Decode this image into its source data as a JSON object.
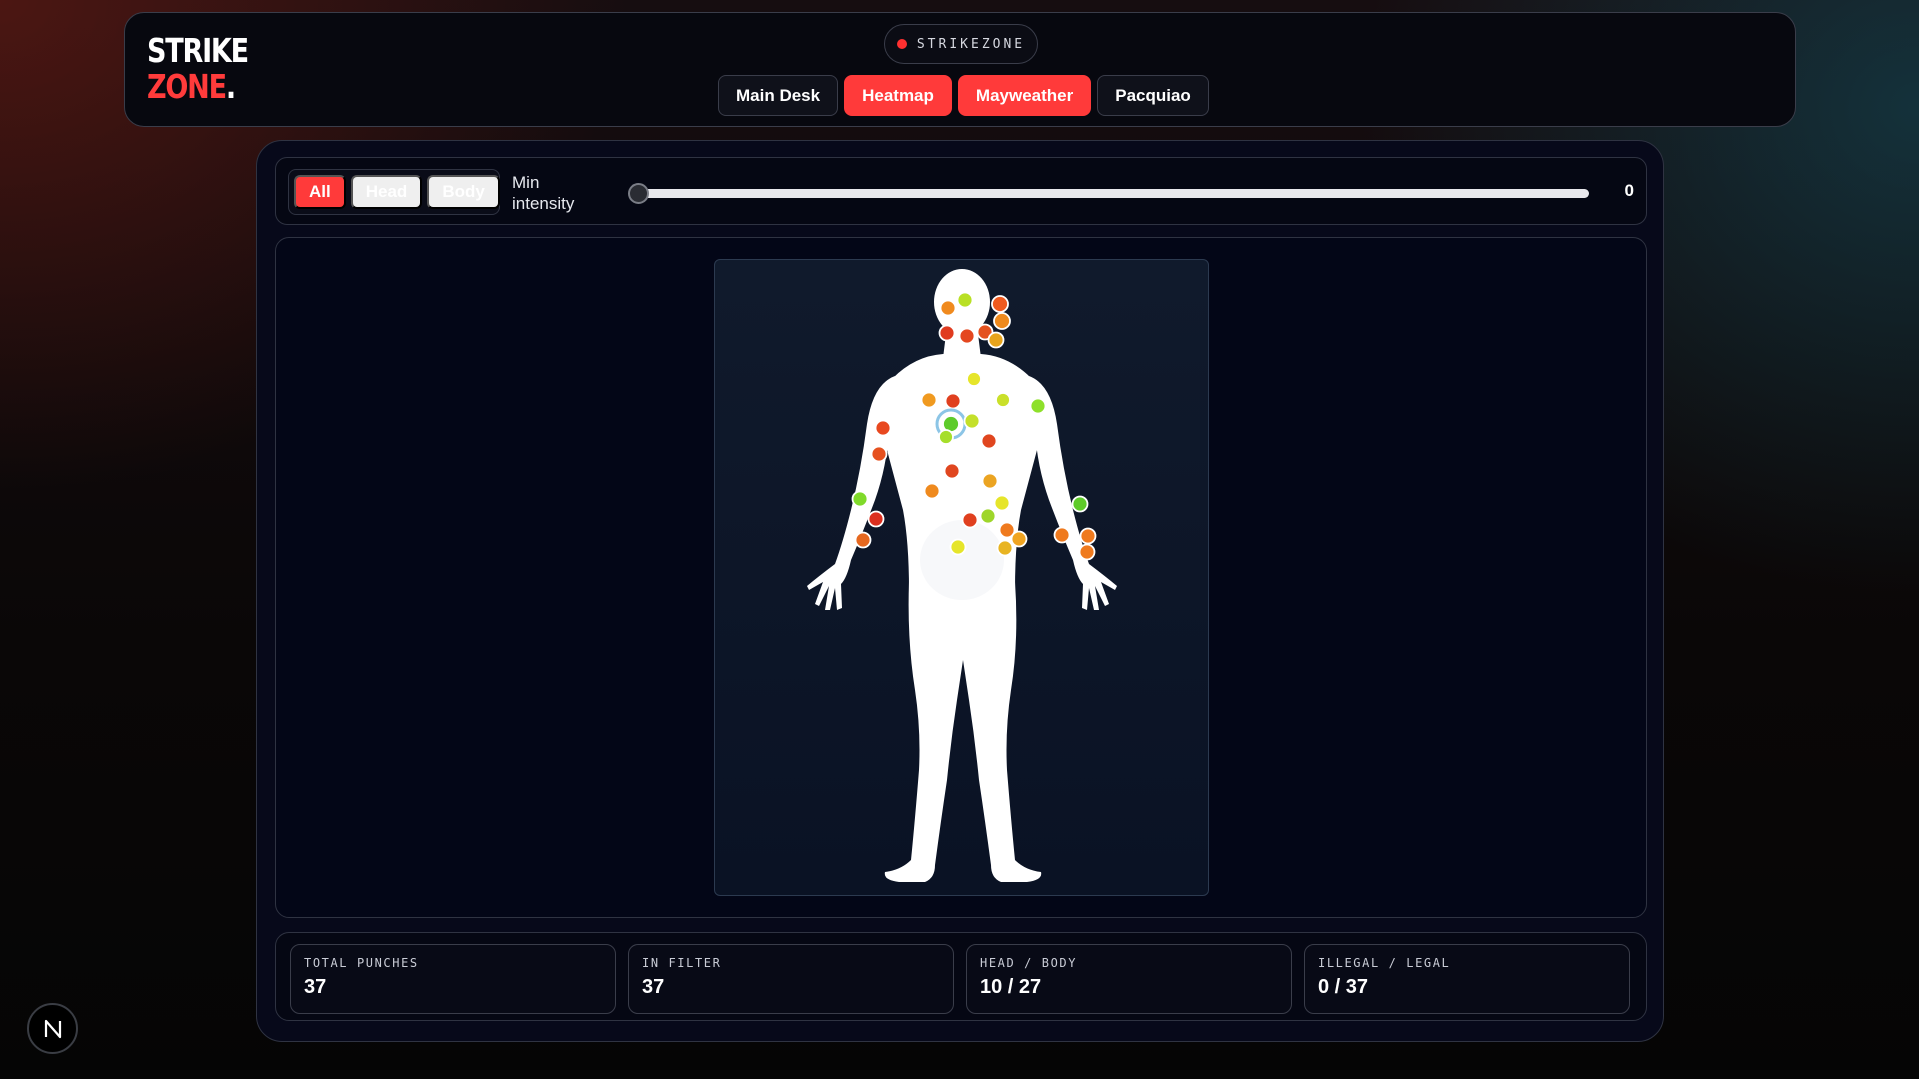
{
  "logo": {
    "line1": "STRIKE",
    "line2": "ZONE",
    "dot": "."
  },
  "brand": {
    "label": "STRIKEZONE",
    "dot_color": "#ff3030"
  },
  "nav": [
    {
      "label": "Main Desk",
      "active": false
    },
    {
      "label": "Heatmap",
      "active": true
    },
    {
      "label": "Mayweather",
      "active": true
    },
    {
      "label": "Pacquiao",
      "active": false
    }
  ],
  "filter": {
    "options": [
      {
        "label": "All",
        "active": true
      },
      {
        "label": "Head",
        "active": false
      },
      {
        "label": "Body",
        "active": false
      }
    ],
    "intensity_label_1": "Min",
    "intensity_label_2": "intensity",
    "min_intensity": "0",
    "slider_fraction": 0
  },
  "heatmap": {
    "icon": "human-body-silhouette",
    "marker_count": 37
  },
  "stats": [
    {
      "label": "TOTAL PUNCHES",
      "value": "37"
    },
    {
      "label": "IN FILTER",
      "value": "37"
    },
    {
      "label": "HEAD / BODY",
      "value": "10 / 27"
    },
    {
      "label": "ILLEGAL / LEGAL",
      "value": "0 / 37"
    }
  ],
  "colors": {
    "accent": "#ff3a3a",
    "panel_bg": "#07091a",
    "border": "#2f3342"
  },
  "corner_badge": {
    "label": "N",
    "icon": "n-logo-icon"
  }
}
